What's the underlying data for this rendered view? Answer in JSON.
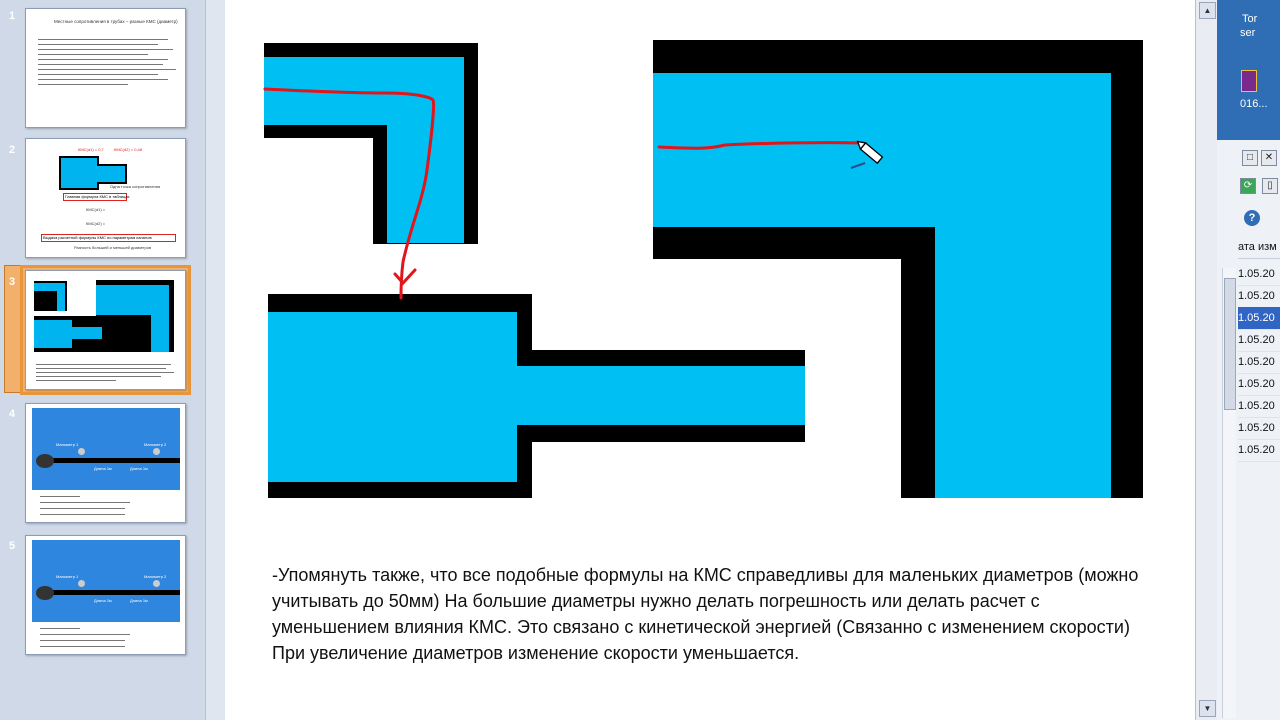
{
  "thumbnails": [
    {
      "num": "1",
      "title": "Местные сопротивления в трубах – разные КМС (диаметр)"
    },
    {
      "num": "2",
      "labels": [
        "КМС(d1) = 0,7",
        "КМС(d2) = 0,48",
        "Одна точка сопротивления",
        "Главная формула КМС в таблицах",
        "КМС(d1) = ",
        "КМС(d2) = ",
        "Выдача расчетной формулы КМС по параметрам каналов",
        "Разность большей и меньшей диаметров"
      ]
    },
    {
      "num": "3"
    },
    {
      "num": "4",
      "labels": [
        "Манометр 1",
        "Манометр 2",
        "Длина 1м",
        "Длина 1м"
      ]
    },
    {
      "num": "5",
      "labels": [
        "Манометр 1",
        "Манометр 2",
        "Длина 1м",
        "Длина 1м"
      ]
    }
  ],
  "slide": {
    "notes": "-Упомянуть также, что все подобные формулы на КМС справедливы для маленьких диаметров (можно учитывать до 50мм) На большие диаметры нужно делать погрешность или делать расчет с уменьшением влияния КМС. Это связано с кинетической энергией (Связанно с изменением скорости) При увеличение диаметров изменение скорости уменьшается."
  },
  "right_panel": {
    "desktop_label_1": "Tor",
    "desktop_label_2": "ser",
    "desktop_label_3": "016...",
    "column_header": "ата изм",
    "dates": [
      "1.05.20",
      "1.05.20",
      "1.05.20",
      "1.05.20",
      "1.05.20",
      "1.05.20",
      "1.05.20",
      "1.05.20",
      "1.05.20"
    ],
    "selected_index": 2
  },
  "colors": {
    "pipe_fill": "#00bff3",
    "pipe_wall": "#000000",
    "ink": "#e0161b",
    "selection": "#e8963b"
  }
}
